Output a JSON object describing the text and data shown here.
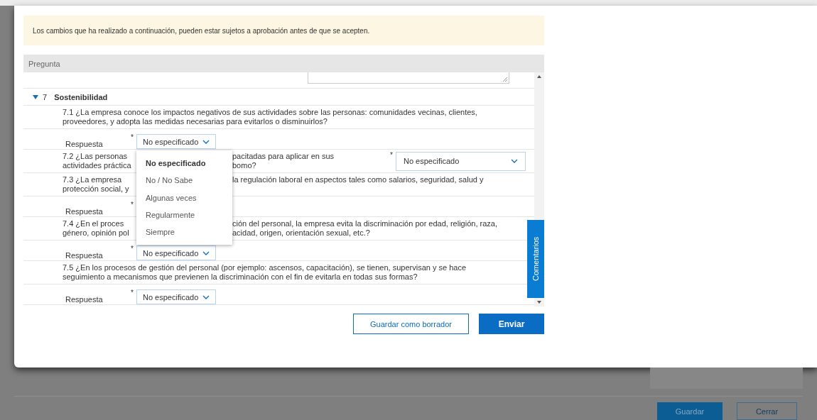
{
  "notice": "Los cambios que ha realizado a continuación, pueden estar sujetos a aprobación antes de que se acepten.",
  "table_header": "Pregunta",
  "section": {
    "number": "7",
    "title": "Sostenibilidad",
    "expanded": true
  },
  "questions": [
    {
      "kind": "stacked",
      "lines": [
        [
          "7.1  ¿La empresa conoce los impactos negativos de sus actividades sobre las personas: comunidades vecinas, clientes,"
        ],
        [
          "proveedores, y adopta las medidas necesarias para evitarlos o disminuirlos?"
        ]
      ],
      "answer": {
        "label": "Respuesta",
        "required_mark": "*",
        "value": "No especificado"
      }
    },
    {
      "kind": "inline",
      "lines": [
        [
          "7.2  ¿Las personas",
          "pacitadas para aplicar en sus"
        ],
        [
          "actividades práctica",
          "bomo?"
        ]
      ],
      "answer": {
        "required_mark": "*",
        "value": "No especificado"
      }
    },
    {
      "kind": "stacked",
      "lines": [
        [
          "7.3  ¿La empresa",
          "la regulación laboral en aspectos tales como salarios, seguridad, salud y"
        ],
        [
          "protección social, y"
        ]
      ],
      "answer": {
        "label": "Respuesta",
        "required_mark": "*"
      }
    },
    {
      "kind": "stacked",
      "lines": [
        [
          "7.4  ¿En el proces",
          "ción del personal, la empresa evita la discriminación por edad, religión, raza,"
        ],
        [
          "género, opinión pol",
          "acidad, origen, orientación sexual, etc.?"
        ]
      ],
      "answer": {
        "label": "Respuesta",
        "required_mark": "*",
        "value": "No especificado"
      }
    },
    {
      "kind": "stacked",
      "lines": [
        [
          "7.5  ¿En los procesos de gestión del personal (por ejemplo: ascensos, capacitación), se tienen, supervisan y se hace"
        ],
        [
          "seguimiento a mecanismos que previenen la discriminación con el fin de evitarla en todas sus formas?"
        ]
      ],
      "answer": {
        "label": "Respuesta",
        "required_mark": "*",
        "value": "No especificado"
      }
    }
  ],
  "dropdown_menu": [
    {
      "label": "No especificado",
      "selected": true
    },
    {
      "label": "No / No Sabe",
      "selected": false
    },
    {
      "label": "Algunas veces",
      "selected": false
    },
    {
      "label": "Regularmente",
      "selected": false
    },
    {
      "label": "Siempre",
      "selected": false
    }
  ],
  "side_tab": "Comentarios",
  "buttons": [
    {
      "label": "Guardar como borrador",
      "kind": "secondary"
    },
    {
      "label": "Enviar",
      "kind": "primary"
    }
  ],
  "background_buttons": [
    {
      "label": "Guardar",
      "kind": "primary"
    },
    {
      "label": "Cerrar",
      "kind": "secondary"
    }
  ]
}
